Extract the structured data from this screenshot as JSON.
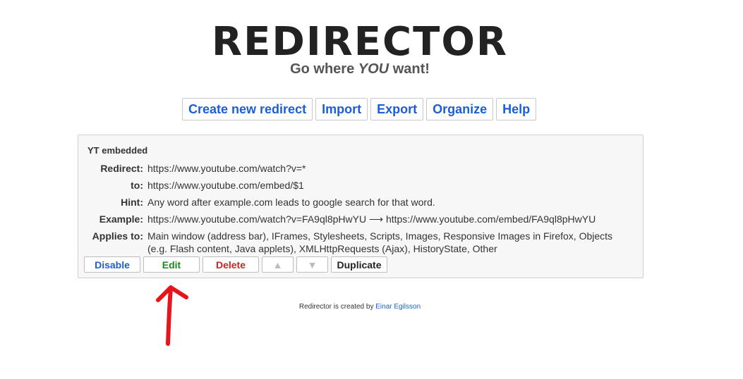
{
  "header": {
    "logo": "REDIRECTOR",
    "tagline_prefix": "Go where",
    "tagline_emphasis": "YOU",
    "tagline_suffix": "want!"
  },
  "menu": {
    "items": [
      {
        "label": "Create new redirect"
      },
      {
        "label": "Import"
      },
      {
        "label": "Export"
      },
      {
        "label": "Organize"
      },
      {
        "label": "Help"
      }
    ]
  },
  "redirect": {
    "title": "YT embedded",
    "fields": [
      {
        "label": "Redirect:",
        "value": "https://www.youtube.com/watch?v=*"
      },
      {
        "label": "to:",
        "value": "https://www.youtube.com/embed/$1"
      },
      {
        "label": "Hint:",
        "value": "Any word after example.com leads to google search for that word."
      },
      {
        "label": "Example:",
        "value": "https://www.youtube.com/watch?v=FA9ql8pHwYU ⟶ https://www.youtube.com/embed/FA9ql8pHwYU"
      },
      {
        "label": "Applies to:",
        "value": "Main window (address bar), IFrames, Stylesheets, Scripts, Images, Responsive Images in Firefox, Objects (e.g. Flash content, Java applets), XMLHttpRequests (Ajax), HistoryState, Other"
      }
    ],
    "actions": {
      "disable": "Disable",
      "edit": "Edit",
      "delete": "Delete",
      "up": "▲",
      "down": "▼",
      "duplicate": "Duplicate"
    }
  },
  "footer": {
    "text": "Redirector is created by",
    "author": "Einar Egilsson"
  },
  "annotation": {
    "color": "#e8141c"
  }
}
